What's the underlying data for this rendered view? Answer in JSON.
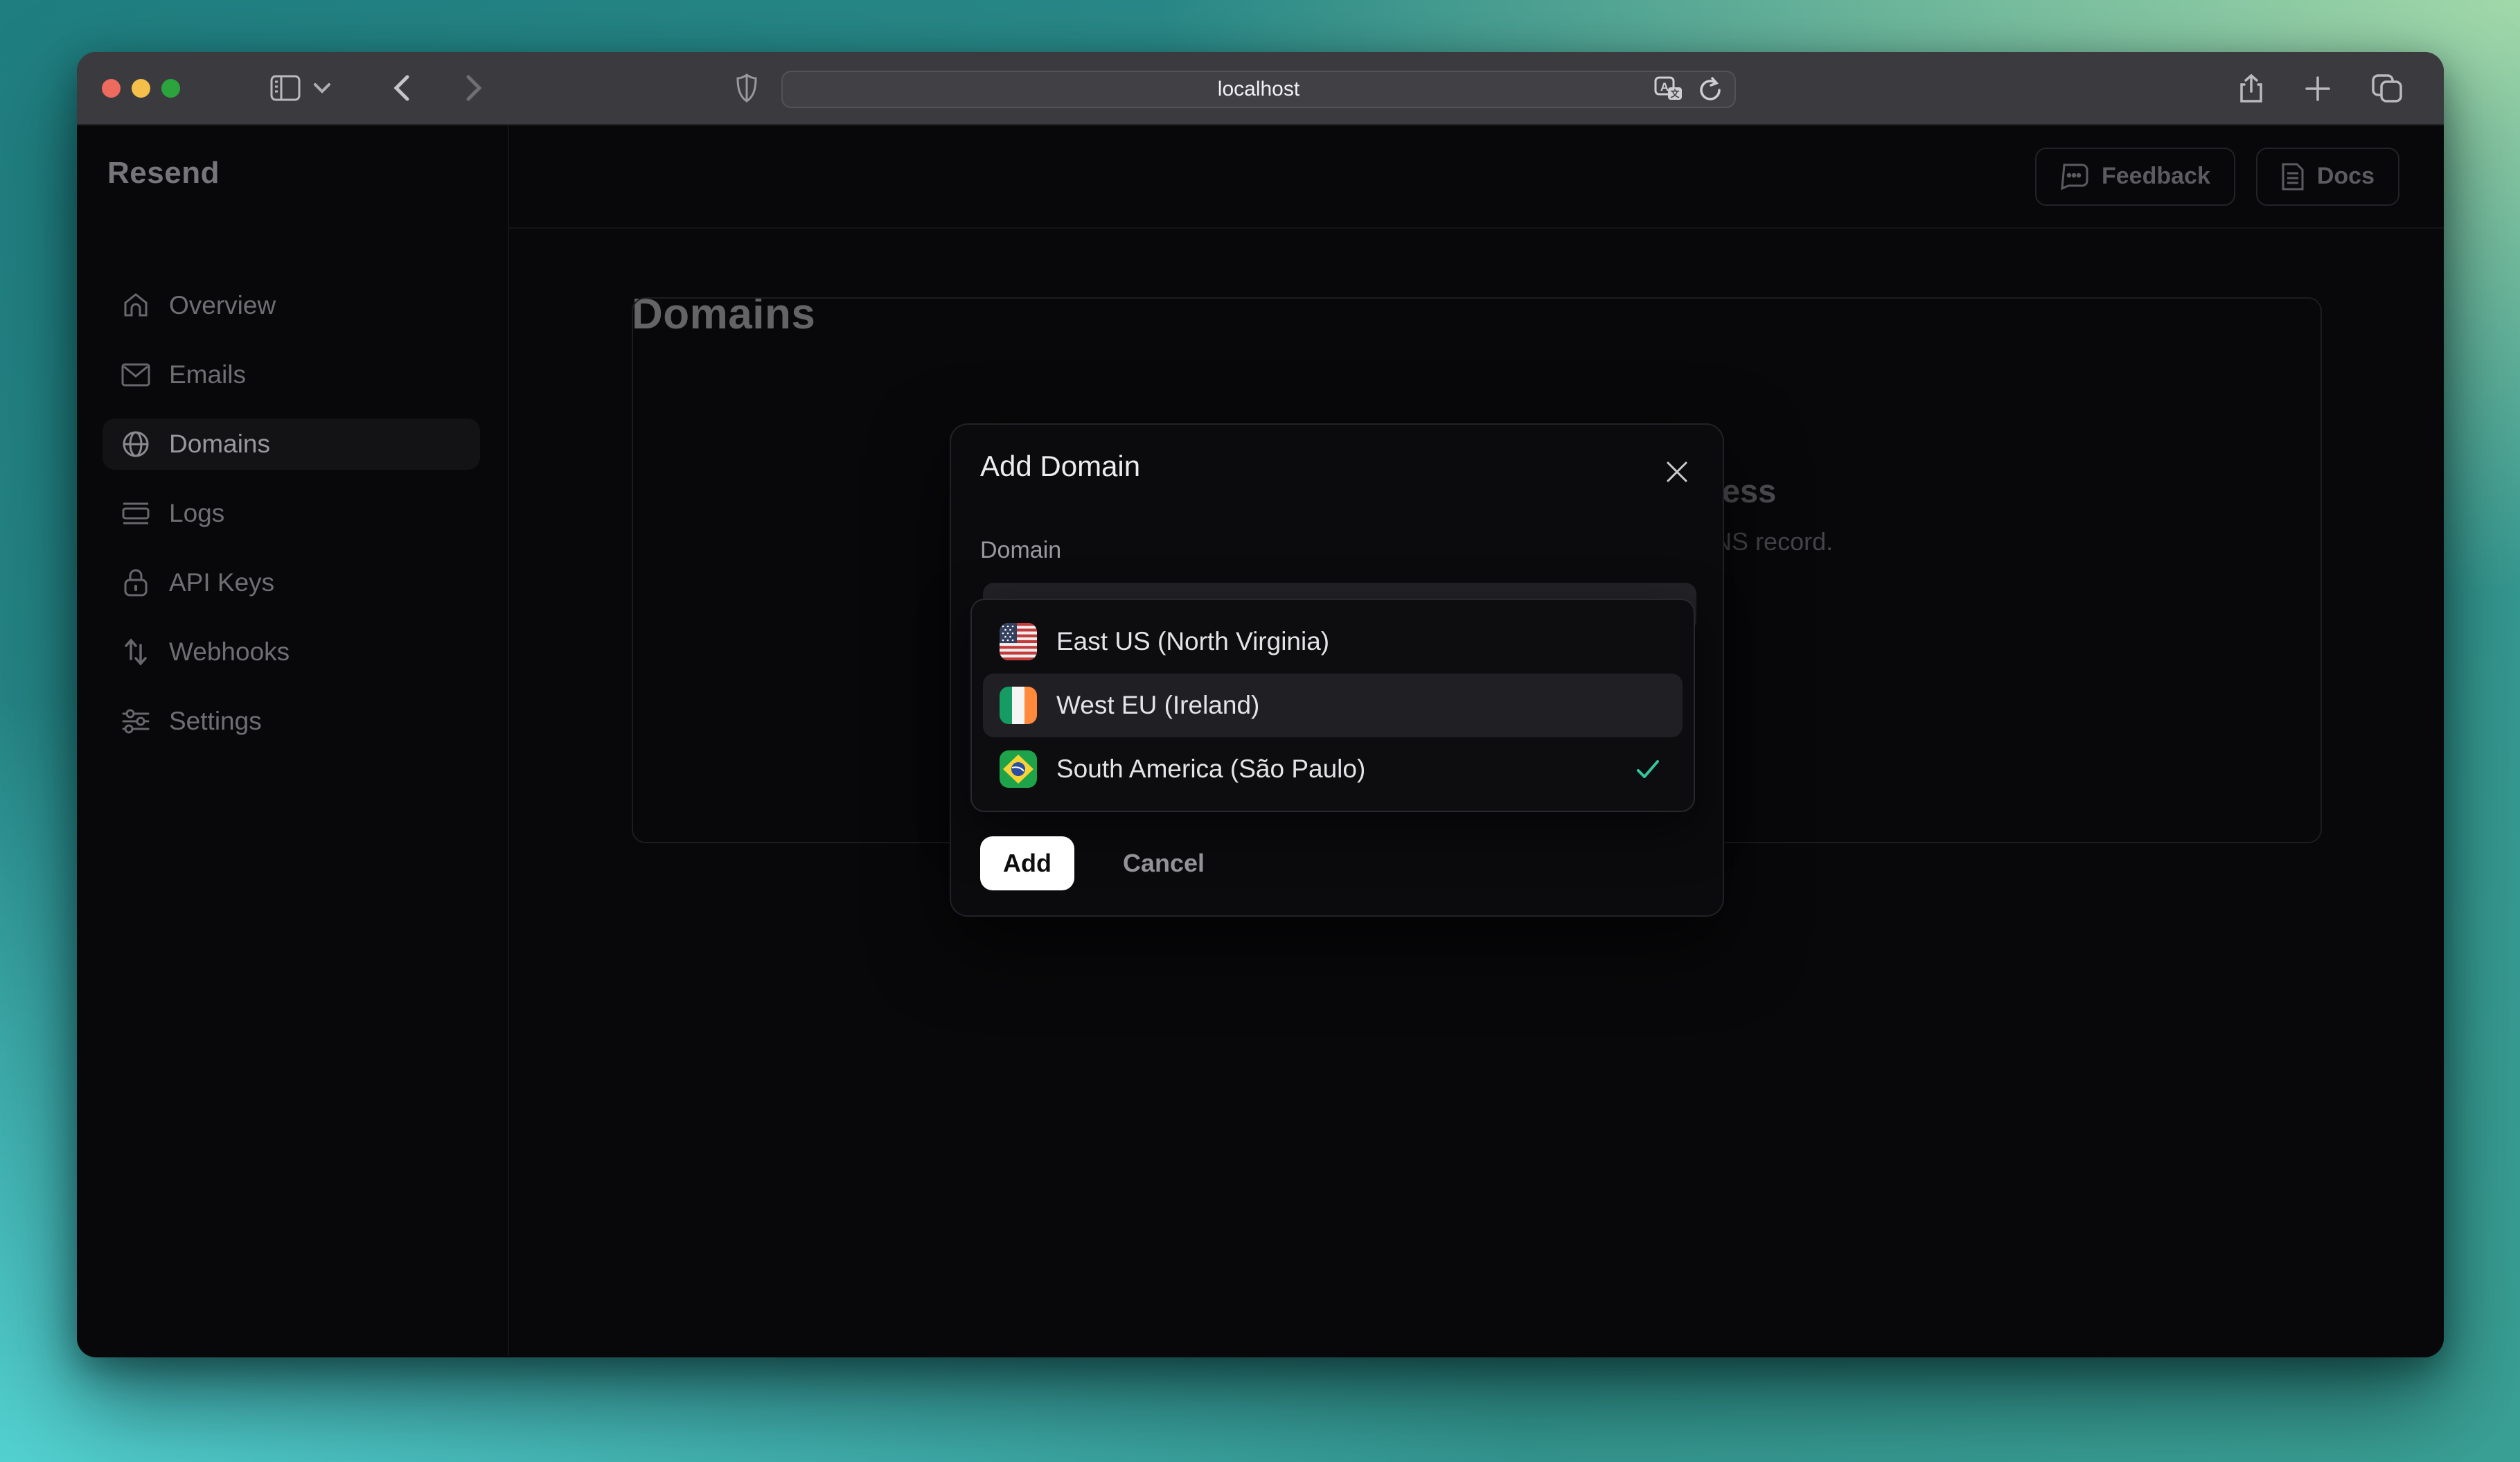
{
  "browser": {
    "url": "localhost"
  },
  "sidebar": {
    "logo": "Resend",
    "items": [
      {
        "label": "Overview",
        "icon": "home-icon",
        "active": false
      },
      {
        "label": "Emails",
        "icon": "mail-icon",
        "active": false
      },
      {
        "label": "Domains",
        "icon": "globe-icon",
        "active": true
      },
      {
        "label": "Logs",
        "icon": "logs-icon",
        "active": false
      },
      {
        "label": "API Keys",
        "icon": "lock-icon",
        "active": false
      },
      {
        "label": "Webhooks",
        "icon": "arrows-up-down-icon",
        "active": false
      },
      {
        "label": "Settings",
        "icon": "sliders-icon",
        "active": false
      }
    ]
  },
  "header": {
    "feedback_label": "Feedback",
    "docs_label": "Docs"
  },
  "main": {
    "title": "Domains",
    "empty_state": {
      "heading_fragment": "address",
      "body_fragment": "g a DNS record."
    }
  },
  "modal": {
    "title": "Add Domain",
    "field_label": "Domain",
    "options": [
      {
        "label": "East US (North Virginia)",
        "flag": "us",
        "highlighted": false,
        "selected": false
      },
      {
        "label": "West EU (Ireland)",
        "flag": "ireland",
        "highlighted": true,
        "selected": false
      },
      {
        "label": "South America (São Paulo)",
        "flag": "brazil",
        "highlighted": false,
        "selected": true
      }
    ],
    "add_label": "Add",
    "cancel_label": "Cancel"
  },
  "colors": {
    "check_accent": "#35c79c",
    "modal_bg": "#0b0b0e",
    "highlight_row": "#202024",
    "add_button_bg": "#ffffff",
    "traffic_red": "#ed6a5e",
    "traffic_yellow": "#f4bf4a",
    "traffic_green": "#2ca43e"
  }
}
